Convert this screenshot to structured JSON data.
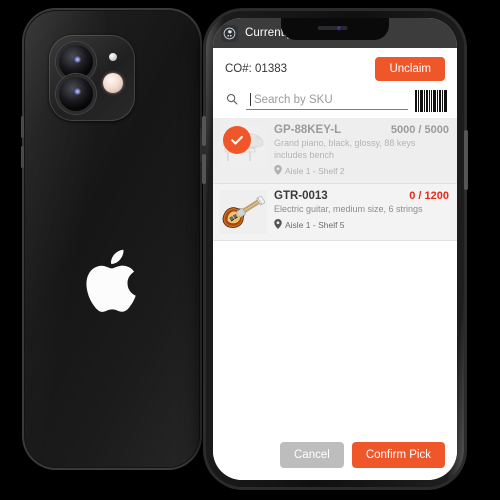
{
  "app": {
    "icon": "app-logo-icon",
    "title": "Currently Picking..."
  },
  "order": {
    "co_label": "CO#: 01383",
    "unclaim_label": "Unclaim"
  },
  "search": {
    "icon": "search-icon",
    "placeholder": "Search by SKU",
    "value": "",
    "barcode_icon": "barcode-icon"
  },
  "items": [
    {
      "sku": "GP-88KEY-L",
      "qty": "5000 / 5000",
      "qty_state": "complete",
      "description": "Grand piano, black, glossy, 88 keys includes bench",
      "location": "Aisle 1 - Shelf 2",
      "thumb_icon": "grand-piano-icon",
      "picked": true,
      "check_icon": "check-icon",
      "pin_icon": "location-pin-icon"
    },
    {
      "sku": "GTR-0013",
      "qty": "0 / 1200",
      "qty_state": "pending",
      "description": "Electric guitar, medium size, 6 strings",
      "location": "Aisle 1 - Shelf 5",
      "thumb_icon": "electric-guitar-icon",
      "picked": false,
      "check_icon": "",
      "pin_icon": "location-pin-icon"
    }
  ],
  "actions": {
    "cancel_label": "Cancel",
    "confirm_label": "Confirm Pick"
  },
  "device": {
    "back_phone_logo": "apple-logo-icon",
    "camera": "dual-camera-module",
    "notch": "front-camera-notch"
  },
  "colors": {
    "accent": "#ef5629",
    "appbar": "#3c3c3c",
    "warn": "#e8291b",
    "underline": "#2196f3",
    "cancel": "#bdbdbd"
  }
}
